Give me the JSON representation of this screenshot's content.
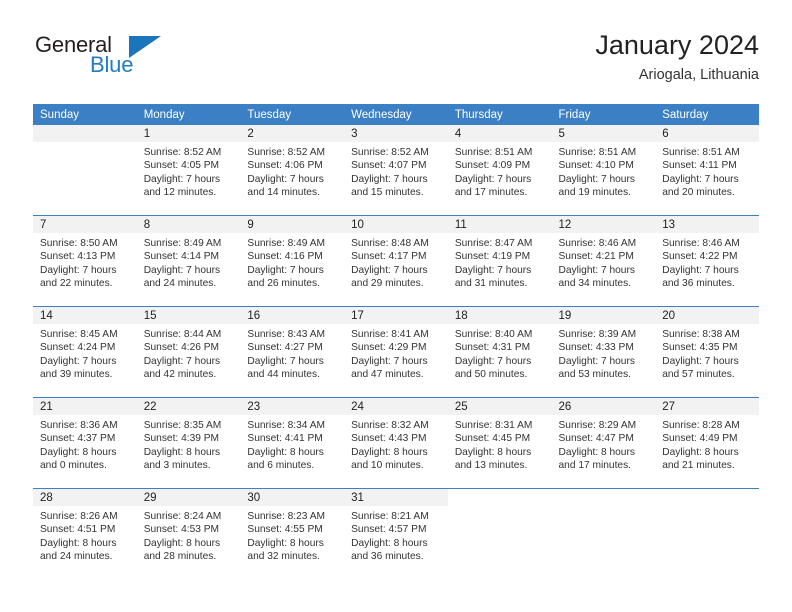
{
  "brand": {
    "name_part1": "General",
    "name_part2": "Blue",
    "triangle_icon": "brand-triangle-icon",
    "accent_color": "#1b75bb"
  },
  "header": {
    "title": "January 2024",
    "location": "Ariogala, Lithuania"
  },
  "theme": {
    "header_blue": "#3b7fc4",
    "daynum_band": "#f2f2f2",
    "text": "#333333"
  },
  "weekday_headers": [
    "Sunday",
    "Monday",
    "Tuesday",
    "Wednesday",
    "Thursday",
    "Friday",
    "Saturday"
  ],
  "weeks": [
    [
      {
        "day": "",
        "sunrise": "",
        "sunset": "",
        "daylight1": "",
        "daylight2": "",
        "empty": true
      },
      {
        "day": "1",
        "sunrise": "Sunrise: 8:52 AM",
        "sunset": "Sunset: 4:05 PM",
        "daylight1": "Daylight: 7 hours",
        "daylight2": "and 12 minutes."
      },
      {
        "day": "2",
        "sunrise": "Sunrise: 8:52 AM",
        "sunset": "Sunset: 4:06 PM",
        "daylight1": "Daylight: 7 hours",
        "daylight2": "and 14 minutes."
      },
      {
        "day": "3",
        "sunrise": "Sunrise: 8:52 AM",
        "sunset": "Sunset: 4:07 PM",
        "daylight1": "Daylight: 7 hours",
        "daylight2": "and 15 minutes."
      },
      {
        "day": "4",
        "sunrise": "Sunrise: 8:51 AM",
        "sunset": "Sunset: 4:09 PM",
        "daylight1": "Daylight: 7 hours",
        "daylight2": "and 17 minutes."
      },
      {
        "day": "5",
        "sunrise": "Sunrise: 8:51 AM",
        "sunset": "Sunset: 4:10 PM",
        "daylight1": "Daylight: 7 hours",
        "daylight2": "and 19 minutes."
      },
      {
        "day": "6",
        "sunrise": "Sunrise: 8:51 AM",
        "sunset": "Sunset: 4:11 PM",
        "daylight1": "Daylight: 7 hours",
        "daylight2": "and 20 minutes."
      }
    ],
    [
      {
        "day": "7",
        "sunrise": "Sunrise: 8:50 AM",
        "sunset": "Sunset: 4:13 PM",
        "daylight1": "Daylight: 7 hours",
        "daylight2": "and 22 minutes."
      },
      {
        "day": "8",
        "sunrise": "Sunrise: 8:49 AM",
        "sunset": "Sunset: 4:14 PM",
        "daylight1": "Daylight: 7 hours",
        "daylight2": "and 24 minutes."
      },
      {
        "day": "9",
        "sunrise": "Sunrise: 8:49 AM",
        "sunset": "Sunset: 4:16 PM",
        "daylight1": "Daylight: 7 hours",
        "daylight2": "and 26 minutes."
      },
      {
        "day": "10",
        "sunrise": "Sunrise: 8:48 AM",
        "sunset": "Sunset: 4:17 PM",
        "daylight1": "Daylight: 7 hours",
        "daylight2": "and 29 minutes."
      },
      {
        "day": "11",
        "sunrise": "Sunrise: 8:47 AM",
        "sunset": "Sunset: 4:19 PM",
        "daylight1": "Daylight: 7 hours",
        "daylight2": "and 31 minutes."
      },
      {
        "day": "12",
        "sunrise": "Sunrise: 8:46 AM",
        "sunset": "Sunset: 4:21 PM",
        "daylight1": "Daylight: 7 hours",
        "daylight2": "and 34 minutes."
      },
      {
        "day": "13",
        "sunrise": "Sunrise: 8:46 AM",
        "sunset": "Sunset: 4:22 PM",
        "daylight1": "Daylight: 7 hours",
        "daylight2": "and 36 minutes."
      }
    ],
    [
      {
        "day": "14",
        "sunrise": "Sunrise: 8:45 AM",
        "sunset": "Sunset: 4:24 PM",
        "daylight1": "Daylight: 7 hours",
        "daylight2": "and 39 minutes."
      },
      {
        "day": "15",
        "sunrise": "Sunrise: 8:44 AM",
        "sunset": "Sunset: 4:26 PM",
        "daylight1": "Daylight: 7 hours",
        "daylight2": "and 42 minutes."
      },
      {
        "day": "16",
        "sunrise": "Sunrise: 8:43 AM",
        "sunset": "Sunset: 4:27 PM",
        "daylight1": "Daylight: 7 hours",
        "daylight2": "and 44 minutes."
      },
      {
        "day": "17",
        "sunrise": "Sunrise: 8:41 AM",
        "sunset": "Sunset: 4:29 PM",
        "daylight1": "Daylight: 7 hours",
        "daylight2": "and 47 minutes."
      },
      {
        "day": "18",
        "sunrise": "Sunrise: 8:40 AM",
        "sunset": "Sunset: 4:31 PM",
        "daylight1": "Daylight: 7 hours",
        "daylight2": "and 50 minutes."
      },
      {
        "day": "19",
        "sunrise": "Sunrise: 8:39 AM",
        "sunset": "Sunset: 4:33 PM",
        "daylight1": "Daylight: 7 hours",
        "daylight2": "and 53 minutes."
      },
      {
        "day": "20",
        "sunrise": "Sunrise: 8:38 AM",
        "sunset": "Sunset: 4:35 PM",
        "daylight1": "Daylight: 7 hours",
        "daylight2": "and 57 minutes."
      }
    ],
    [
      {
        "day": "21",
        "sunrise": "Sunrise: 8:36 AM",
        "sunset": "Sunset: 4:37 PM",
        "daylight1": "Daylight: 8 hours",
        "daylight2": "and 0 minutes."
      },
      {
        "day": "22",
        "sunrise": "Sunrise: 8:35 AM",
        "sunset": "Sunset: 4:39 PM",
        "daylight1": "Daylight: 8 hours",
        "daylight2": "and 3 minutes."
      },
      {
        "day": "23",
        "sunrise": "Sunrise: 8:34 AM",
        "sunset": "Sunset: 4:41 PM",
        "daylight1": "Daylight: 8 hours",
        "daylight2": "and 6 minutes."
      },
      {
        "day": "24",
        "sunrise": "Sunrise: 8:32 AM",
        "sunset": "Sunset: 4:43 PM",
        "daylight1": "Daylight: 8 hours",
        "daylight2": "and 10 minutes."
      },
      {
        "day": "25",
        "sunrise": "Sunrise: 8:31 AM",
        "sunset": "Sunset: 4:45 PM",
        "daylight1": "Daylight: 8 hours",
        "daylight2": "and 13 minutes."
      },
      {
        "day": "26",
        "sunrise": "Sunrise: 8:29 AM",
        "sunset": "Sunset: 4:47 PM",
        "daylight1": "Daylight: 8 hours",
        "daylight2": "and 17 minutes."
      },
      {
        "day": "27",
        "sunrise": "Sunrise: 8:28 AM",
        "sunset": "Sunset: 4:49 PM",
        "daylight1": "Daylight: 8 hours",
        "daylight2": "and 21 minutes."
      }
    ],
    [
      {
        "day": "28",
        "sunrise": "Sunrise: 8:26 AM",
        "sunset": "Sunset: 4:51 PM",
        "daylight1": "Daylight: 8 hours",
        "daylight2": "and 24 minutes."
      },
      {
        "day": "29",
        "sunrise": "Sunrise: 8:24 AM",
        "sunset": "Sunset: 4:53 PM",
        "daylight1": "Daylight: 8 hours",
        "daylight2": "and 28 minutes."
      },
      {
        "day": "30",
        "sunrise": "Sunrise: 8:23 AM",
        "sunset": "Sunset: 4:55 PM",
        "daylight1": "Daylight: 8 hours",
        "daylight2": "and 32 minutes."
      },
      {
        "day": "31",
        "sunrise": "Sunrise: 8:21 AM",
        "sunset": "Sunset: 4:57 PM",
        "daylight1": "Daylight: 8 hours",
        "daylight2": "and 36 minutes."
      },
      {
        "day": "",
        "sunrise": "",
        "sunset": "",
        "daylight1": "",
        "daylight2": "",
        "blank": true
      },
      {
        "day": "",
        "sunrise": "",
        "sunset": "",
        "daylight1": "",
        "daylight2": "",
        "blank": true
      },
      {
        "day": "",
        "sunrise": "",
        "sunset": "",
        "daylight1": "",
        "daylight2": "",
        "blank": true
      }
    ]
  ]
}
